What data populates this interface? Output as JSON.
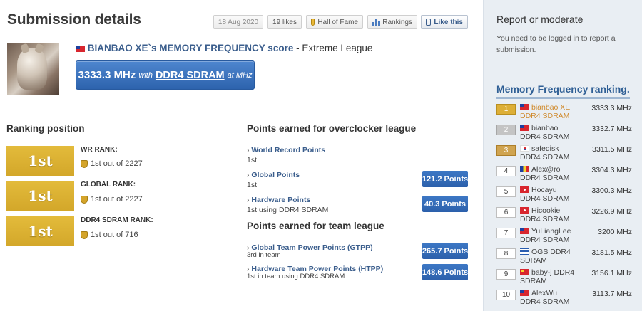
{
  "page": {
    "title": "Submission details"
  },
  "toolbar": {
    "date": "18 Aug 2020",
    "likes": "19 likes",
    "hall_of_fame": "Hall of Fame",
    "rankings": "Rankings",
    "like_this": "Like this"
  },
  "submission": {
    "user": "BIANBAO XE",
    "mid": "`s MEMORY FREQUENCY score",
    "league": " - Extreme League",
    "value": "3333.3 MHz",
    "with": "with",
    "memory": "DDR4 SDRAM",
    "at": "at MHz"
  },
  "ranking": {
    "heading": "Ranking position",
    "items": [
      {
        "badge": "1st",
        "label": "WR RANK:",
        "value": "1st out of 2227"
      },
      {
        "badge": "1st",
        "label": "GLOBAL RANK:",
        "value": "1st out of 2227"
      },
      {
        "badge": "1st",
        "label": "DDR4 SDRAM RANK:",
        "value": "1st out of 716"
      }
    ]
  },
  "points": {
    "heading": "Points earned for overclocker league",
    "items": [
      {
        "title": "World Record Points",
        "sub": "1st",
        "pill": ""
      },
      {
        "title": "Global Points",
        "sub": "1st",
        "pill": "121.2 Points"
      },
      {
        "title": "Hardware Points",
        "sub": "1st using DDR4 SDRAM",
        "pill": "40.3 Points"
      }
    ]
  },
  "team": {
    "heading": "Points earned for team league",
    "items": [
      {
        "title": "Global Team Power Points (GTPP)",
        "sub": "3rd in team",
        "pill": "265.7 Points"
      },
      {
        "title": "Hardware Team Power Points (HTPP)",
        "sub": "1st in team using DDR4 SDRAM",
        "pill": "148.6 Points"
      }
    ]
  },
  "sidebar": {
    "report_heading": "Report or moderate",
    "report_text": "You need to be logged in to report a submission.",
    "ranking_heading": "Memory Frequency ranking.",
    "rows": [
      {
        "rank": "1",
        "flag": "tw",
        "name": "bianbao XE DDR4 SDRAM",
        "score": "3333.3 MHz"
      },
      {
        "rank": "2",
        "flag": "tw",
        "name": "bianbao DDR4 SDRAM",
        "score": "3332.7 MHz"
      },
      {
        "rank": "3",
        "flag": "kr",
        "name": "safedisk DDR4 SDRAM",
        "score": "3311.5 MHz"
      },
      {
        "rank": "4",
        "flag": "ro",
        "name": "Alex@ro DDR4 SDRAM",
        "score": "3304.3 MHz"
      },
      {
        "rank": "5",
        "flag": "hk",
        "name": "Hocayu DDR4 SDRAM",
        "score": "3300.3 MHz"
      },
      {
        "rank": "6",
        "flag": "hk",
        "name": "Hicookie DDR4 SDRAM",
        "score": "3226.9 MHz"
      },
      {
        "rank": "7",
        "flag": "tw",
        "name": "YuLiangLee DDR4 SDRAM",
        "score": "3200 MHz"
      },
      {
        "rank": "8",
        "flag": "gr",
        "name": "OGS DDR4 SDRAM",
        "score": "3181.5 MHz"
      },
      {
        "rank": "9",
        "flag": "cn",
        "name": "baby-j DDR4 SDRAM",
        "score": "3156.1 MHz"
      },
      {
        "rank": "10",
        "flag": "tw",
        "name": "AlexWu DDR4 SDRAM",
        "score": "3113.7 MHz"
      }
    ]
  }
}
